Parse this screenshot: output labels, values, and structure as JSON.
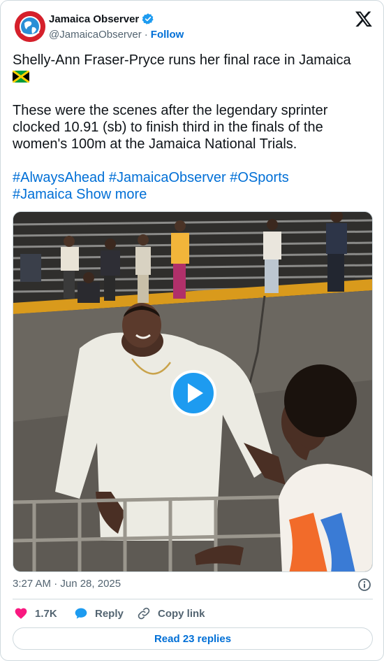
{
  "author": {
    "display_name": "Jamaica Observer",
    "handle": "@JamaicaObserver",
    "separator": "·",
    "follow_label": "Follow",
    "verified": true
  },
  "tweet": {
    "line1": "Shelly-Ann Fraser-Pryce runs her final race in Jamaica",
    "paragraph2": "These were the scenes after the legendary sprinter clocked 10.91 (sb) to finish third in the finals of the women's 100m at the Jamaica National Trials.",
    "hashtags": [
      "#AlwaysAhead",
      "#JamaicaObserver",
      "#OSports",
      "#Jamaica"
    ],
    "show_more": "Show more"
  },
  "media": {
    "type": "video",
    "play_icon": "play-icon"
  },
  "timestamp": "3:27 AM · Jun 28, 2025",
  "actions": {
    "likes": "1.7K",
    "reply_label": "Reply",
    "copy_link_label": "Copy link"
  },
  "read_replies_label": "Read 23 replies",
  "colors": {
    "link": "#006fd6",
    "heart": "#f91880",
    "reply_bubble": "#1d9bf0",
    "verified": "#1d9bf0",
    "text": "#0f1419",
    "muted": "#536471",
    "border": "#cfd9de"
  }
}
